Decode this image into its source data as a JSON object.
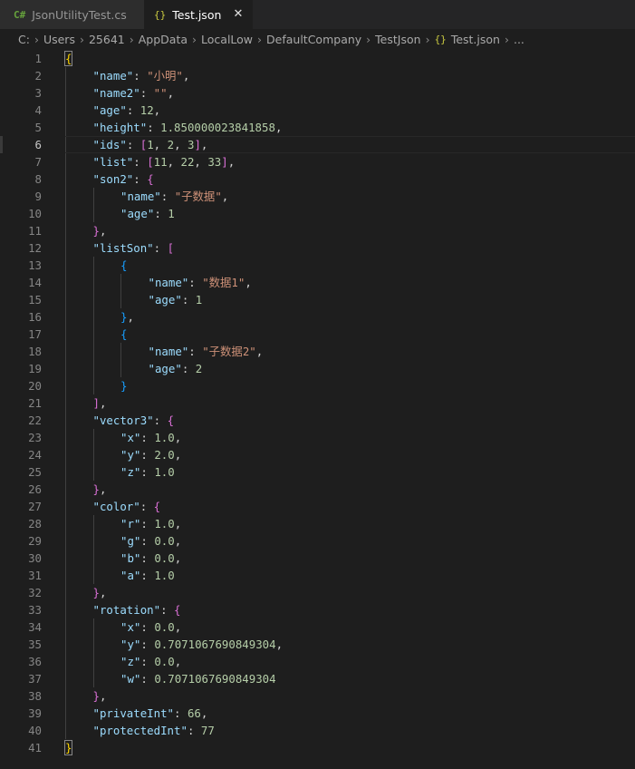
{
  "tabs": [
    {
      "icon": "C#",
      "label": "JsonUtilityTest.cs",
      "active": false
    },
    {
      "icon": "{}",
      "label": "Test.json",
      "active": true,
      "close": "✕"
    }
  ],
  "breadcrumb": {
    "items": [
      "C:",
      "Users",
      "25641",
      "AppData",
      "LocalLow",
      "DefaultCompany",
      "TestJson"
    ],
    "file": "Test.json",
    "ellipsis": "..."
  },
  "editor": {
    "cursor_line": 6,
    "colors": {
      "key": "#9cdcfe",
      "string": "#ce9178",
      "number": "#b5cea8",
      "bracket_level1": "#ffd700",
      "bracket_level2": "#da70d6",
      "bracket_level3": "#179fff"
    },
    "lines": [
      {
        "indent": 0,
        "tokens": [
          [
            "b0",
            "{"
          ]
        ]
      },
      {
        "indent": 1,
        "tokens": [
          [
            "k",
            "\"name\""
          ],
          [
            "p",
            ": "
          ],
          [
            "s",
            "\"小明\""
          ],
          [
            "p",
            ","
          ]
        ]
      },
      {
        "indent": 1,
        "tokens": [
          [
            "k",
            "\"name2\""
          ],
          [
            "p",
            ": "
          ],
          [
            "s",
            "\"\""
          ],
          [
            "p",
            ","
          ]
        ]
      },
      {
        "indent": 1,
        "tokens": [
          [
            "k",
            "\"age\""
          ],
          [
            "p",
            ": "
          ],
          [
            "n",
            "12"
          ],
          [
            "p",
            ","
          ]
        ]
      },
      {
        "indent": 1,
        "tokens": [
          [
            "k",
            "\"height\""
          ],
          [
            "p",
            ": "
          ],
          [
            "n",
            "1.850000023841858"
          ],
          [
            "p",
            ","
          ]
        ]
      },
      {
        "indent": 1,
        "tokens": [
          [
            "k",
            "\"ids\""
          ],
          [
            "p",
            ": "
          ],
          [
            "b1",
            "["
          ],
          [
            "n",
            "1"
          ],
          [
            "p",
            ", "
          ],
          [
            "n",
            "2"
          ],
          [
            "p",
            ", "
          ],
          [
            "n",
            "3"
          ],
          [
            "b1",
            "]"
          ],
          [
            "p",
            ","
          ]
        ]
      },
      {
        "indent": 1,
        "tokens": [
          [
            "k",
            "\"list\""
          ],
          [
            "p",
            ": "
          ],
          [
            "b1",
            "["
          ],
          [
            "n",
            "11"
          ],
          [
            "p",
            ", "
          ],
          [
            "n",
            "22"
          ],
          [
            "p",
            ", "
          ],
          [
            "n",
            "33"
          ],
          [
            "b1",
            "]"
          ],
          [
            "p",
            ","
          ]
        ]
      },
      {
        "indent": 1,
        "tokens": [
          [
            "k",
            "\"son2\""
          ],
          [
            "p",
            ": "
          ],
          [
            "b1",
            "{"
          ]
        ]
      },
      {
        "indent": 2,
        "tokens": [
          [
            "k",
            "\"name\""
          ],
          [
            "p",
            ": "
          ],
          [
            "s",
            "\"子数据\""
          ],
          [
            "p",
            ","
          ]
        ]
      },
      {
        "indent": 2,
        "tokens": [
          [
            "k",
            "\"age\""
          ],
          [
            "p",
            ": "
          ],
          [
            "n",
            "1"
          ]
        ]
      },
      {
        "indent": 1,
        "tokens": [
          [
            "b1",
            "}"
          ],
          [
            "p",
            ","
          ]
        ]
      },
      {
        "indent": 1,
        "tokens": [
          [
            "k",
            "\"listSon\""
          ],
          [
            "p",
            ": "
          ],
          [
            "b1",
            "["
          ]
        ]
      },
      {
        "indent": 2,
        "tokens": [
          [
            "b2",
            "{"
          ]
        ]
      },
      {
        "indent": 3,
        "tokens": [
          [
            "k",
            "\"name\""
          ],
          [
            "p",
            ": "
          ],
          [
            "s",
            "\"数据1\""
          ],
          [
            "p",
            ","
          ]
        ]
      },
      {
        "indent": 3,
        "tokens": [
          [
            "k",
            "\"age\""
          ],
          [
            "p",
            ": "
          ],
          [
            "n",
            "1"
          ]
        ]
      },
      {
        "indent": 2,
        "tokens": [
          [
            "b2",
            "}"
          ],
          [
            "p",
            ","
          ]
        ]
      },
      {
        "indent": 2,
        "tokens": [
          [
            "b2",
            "{"
          ]
        ]
      },
      {
        "indent": 3,
        "tokens": [
          [
            "k",
            "\"name\""
          ],
          [
            "p",
            ": "
          ],
          [
            "s",
            "\"子数据2\""
          ],
          [
            "p",
            ","
          ]
        ]
      },
      {
        "indent": 3,
        "tokens": [
          [
            "k",
            "\"age\""
          ],
          [
            "p",
            ": "
          ],
          [
            "n",
            "2"
          ]
        ]
      },
      {
        "indent": 2,
        "tokens": [
          [
            "b2",
            "}"
          ]
        ]
      },
      {
        "indent": 1,
        "tokens": [
          [
            "b1",
            "]"
          ],
          [
            "p",
            ","
          ]
        ]
      },
      {
        "indent": 1,
        "tokens": [
          [
            "k",
            "\"vector3\""
          ],
          [
            "p",
            ": "
          ],
          [
            "b1",
            "{"
          ]
        ]
      },
      {
        "indent": 2,
        "tokens": [
          [
            "k",
            "\"x\""
          ],
          [
            "p",
            ": "
          ],
          [
            "n",
            "1.0"
          ],
          [
            "p",
            ","
          ]
        ]
      },
      {
        "indent": 2,
        "tokens": [
          [
            "k",
            "\"y\""
          ],
          [
            "p",
            ": "
          ],
          [
            "n",
            "2.0"
          ],
          [
            "p",
            ","
          ]
        ]
      },
      {
        "indent": 2,
        "tokens": [
          [
            "k",
            "\"z\""
          ],
          [
            "p",
            ": "
          ],
          [
            "n",
            "1.0"
          ]
        ]
      },
      {
        "indent": 1,
        "tokens": [
          [
            "b1",
            "}"
          ],
          [
            "p",
            ","
          ]
        ]
      },
      {
        "indent": 1,
        "tokens": [
          [
            "k",
            "\"color\""
          ],
          [
            "p",
            ": "
          ],
          [
            "b1",
            "{"
          ]
        ]
      },
      {
        "indent": 2,
        "tokens": [
          [
            "k",
            "\"r\""
          ],
          [
            "p",
            ": "
          ],
          [
            "n",
            "1.0"
          ],
          [
            "p",
            ","
          ]
        ]
      },
      {
        "indent": 2,
        "tokens": [
          [
            "k",
            "\"g\""
          ],
          [
            "p",
            ": "
          ],
          [
            "n",
            "0.0"
          ],
          [
            "p",
            ","
          ]
        ]
      },
      {
        "indent": 2,
        "tokens": [
          [
            "k",
            "\"b\""
          ],
          [
            "p",
            ": "
          ],
          [
            "n",
            "0.0"
          ],
          [
            "p",
            ","
          ]
        ]
      },
      {
        "indent": 2,
        "tokens": [
          [
            "k",
            "\"a\""
          ],
          [
            "p",
            ": "
          ],
          [
            "n",
            "1.0"
          ]
        ]
      },
      {
        "indent": 1,
        "tokens": [
          [
            "b1",
            "}"
          ],
          [
            "p",
            ","
          ]
        ]
      },
      {
        "indent": 1,
        "tokens": [
          [
            "k",
            "\"rotation\""
          ],
          [
            "p",
            ": "
          ],
          [
            "b1",
            "{"
          ]
        ]
      },
      {
        "indent": 2,
        "tokens": [
          [
            "k",
            "\"x\""
          ],
          [
            "p",
            ": "
          ],
          [
            "n",
            "0.0"
          ],
          [
            "p",
            ","
          ]
        ]
      },
      {
        "indent": 2,
        "tokens": [
          [
            "k",
            "\"y\""
          ],
          [
            "p",
            ": "
          ],
          [
            "n",
            "0.7071067690849304"
          ],
          [
            "p",
            ","
          ]
        ]
      },
      {
        "indent": 2,
        "tokens": [
          [
            "k",
            "\"z\""
          ],
          [
            "p",
            ": "
          ],
          [
            "n",
            "0.0"
          ],
          [
            "p",
            ","
          ]
        ]
      },
      {
        "indent": 2,
        "tokens": [
          [
            "k",
            "\"w\""
          ],
          [
            "p",
            ": "
          ],
          [
            "n",
            "0.7071067690849304"
          ]
        ]
      },
      {
        "indent": 1,
        "tokens": [
          [
            "b1",
            "}"
          ],
          [
            "p",
            ","
          ]
        ]
      },
      {
        "indent": 1,
        "tokens": [
          [
            "k",
            "\"privateInt\""
          ],
          [
            "p",
            ": "
          ],
          [
            "n",
            "66"
          ],
          [
            "p",
            ","
          ]
        ]
      },
      {
        "indent": 1,
        "tokens": [
          [
            "k",
            "\"protectedInt\""
          ],
          [
            "p",
            ": "
          ],
          [
            "n",
            "77"
          ]
        ]
      },
      {
        "indent": 0,
        "tokens": [
          [
            "b0",
            "}"
          ]
        ]
      }
    ]
  }
}
